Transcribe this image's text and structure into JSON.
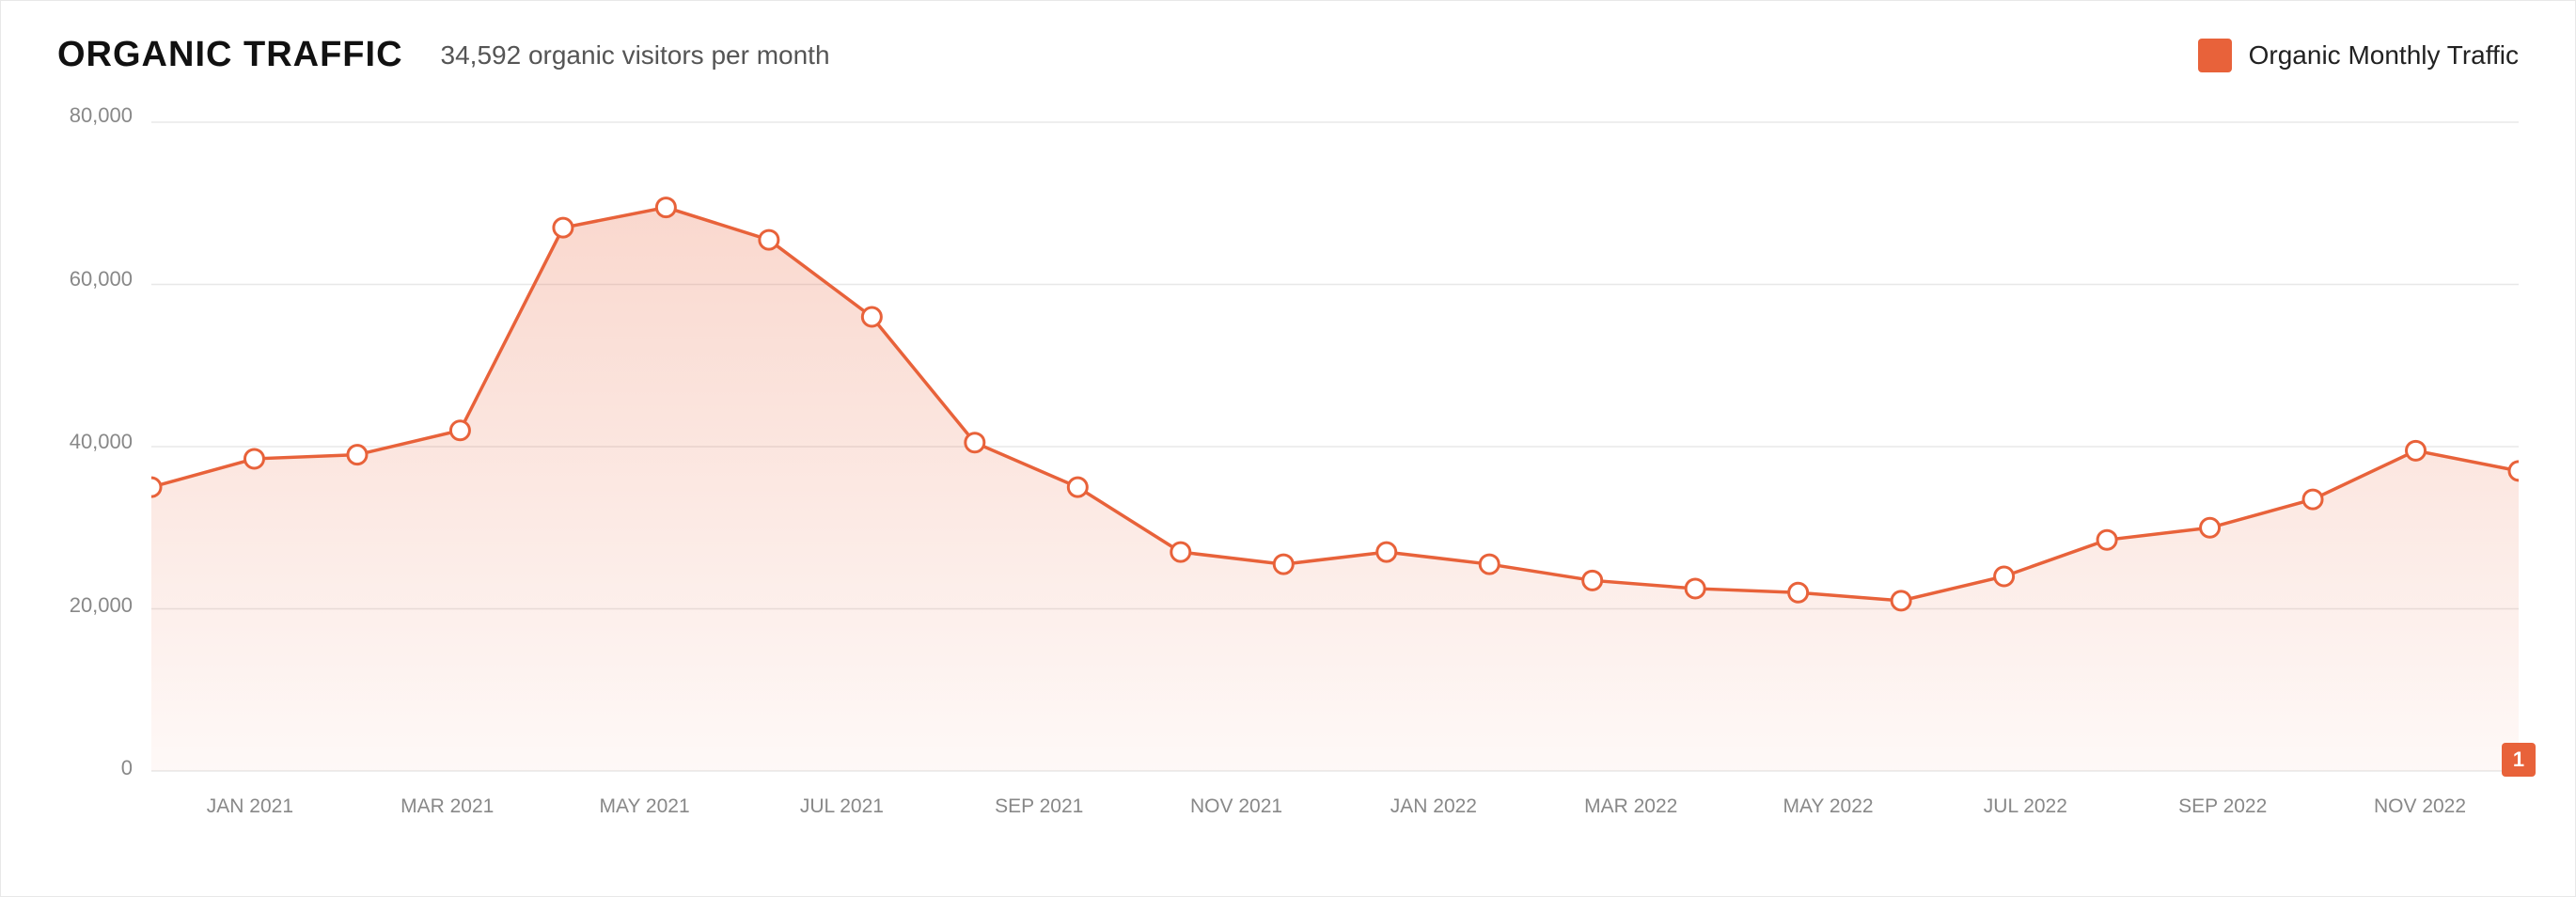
{
  "header": {
    "title": "ORGANIC TRAFFIC",
    "subtitle": "34,592 organic visitors per month",
    "legend_label": "Organic Monthly Traffic"
  },
  "chart": {
    "y_labels": [
      "80,000",
      "60,000",
      "40,000",
      "20,000",
      "0"
    ],
    "x_labels": [
      "JAN 2021",
      "MAR 2021",
      "MAY 2021",
      "JUL 2021",
      "SEP 2021",
      "NOV 2021",
      "JAN 2022",
      "MAR 2022",
      "MAY 2022",
      "JUL 2022",
      "SEP 2022",
      "NOV 2022"
    ],
    "badge": "1",
    "accent_color": "#e8623a",
    "data_points": [
      {
        "month": "JAN 2021",
        "value": 35000
      },
      {
        "month": "FEB 2021",
        "value": 38500
      },
      {
        "month": "MAR 2021",
        "value": 39000
      },
      {
        "month": "APR 2021",
        "value": 42000
      },
      {
        "month": "MAY 2021",
        "value": 67000
      },
      {
        "month": "JUN 2021",
        "value": 69500
      },
      {
        "month": "JUL 2021",
        "value": 65500
      },
      {
        "month": "AUG 2021",
        "value": 56000
      },
      {
        "month": "SEP 2021",
        "value": 40500
      },
      {
        "month": "OCT 2021",
        "value": 35000
      },
      {
        "month": "NOV 2021",
        "value": 27000
      },
      {
        "month": "DEC 2021",
        "value": 25500
      },
      {
        "month": "JAN 2022",
        "value": 27000
      },
      {
        "month": "FEB 2022",
        "value": 25500
      },
      {
        "month": "MAR 2022",
        "value": 23500
      },
      {
        "month": "APR 2022",
        "value": 22500
      },
      {
        "month": "MAY 2022",
        "value": 22000
      },
      {
        "month": "JUN 2022",
        "value": 21000
      },
      {
        "month": "JUL 2022",
        "value": 24000
      },
      {
        "month": "AUG 2022",
        "value": 28500
      },
      {
        "month": "SEP 2022",
        "value": 30000
      },
      {
        "month": "OCT 2022",
        "value": 33500
      },
      {
        "month": "NOV 2022",
        "value": 39500
      },
      {
        "month": "DEC 2022",
        "value": 37000
      }
    ],
    "max_value": 80000,
    "grid_lines": [
      80000,
      60000,
      40000,
      20000,
      0
    ]
  }
}
